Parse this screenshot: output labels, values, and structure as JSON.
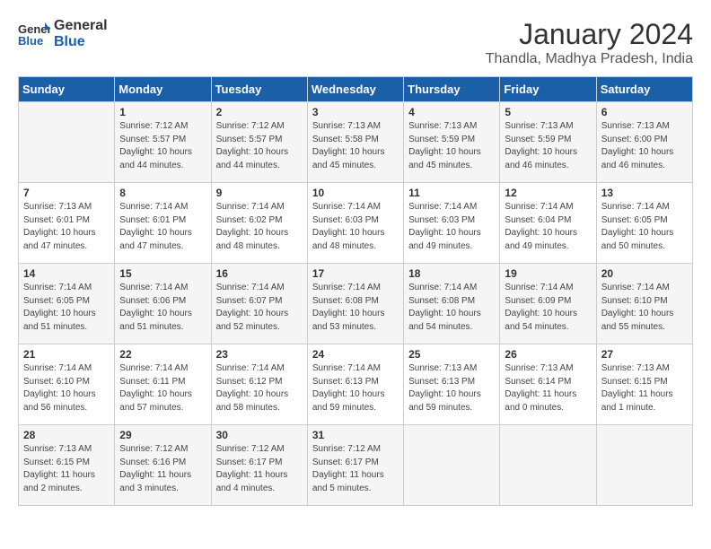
{
  "header": {
    "logo_line1": "General",
    "logo_line2": "Blue",
    "month": "January 2024",
    "location": "Thandla, Madhya Pradesh, India"
  },
  "days_of_week": [
    "Sunday",
    "Monday",
    "Tuesday",
    "Wednesday",
    "Thursday",
    "Friday",
    "Saturday"
  ],
  "weeks": [
    [
      {
        "day": "",
        "info": ""
      },
      {
        "day": "1",
        "info": "Sunrise: 7:12 AM\nSunset: 5:57 PM\nDaylight: 10 hours\nand 44 minutes."
      },
      {
        "day": "2",
        "info": "Sunrise: 7:12 AM\nSunset: 5:57 PM\nDaylight: 10 hours\nand 44 minutes."
      },
      {
        "day": "3",
        "info": "Sunrise: 7:13 AM\nSunset: 5:58 PM\nDaylight: 10 hours\nand 45 minutes."
      },
      {
        "day": "4",
        "info": "Sunrise: 7:13 AM\nSunset: 5:59 PM\nDaylight: 10 hours\nand 45 minutes."
      },
      {
        "day": "5",
        "info": "Sunrise: 7:13 AM\nSunset: 5:59 PM\nDaylight: 10 hours\nand 46 minutes."
      },
      {
        "day": "6",
        "info": "Sunrise: 7:13 AM\nSunset: 6:00 PM\nDaylight: 10 hours\nand 46 minutes."
      }
    ],
    [
      {
        "day": "7",
        "info": "Sunrise: 7:13 AM\nSunset: 6:01 PM\nDaylight: 10 hours\nand 47 minutes."
      },
      {
        "day": "8",
        "info": "Sunrise: 7:14 AM\nSunset: 6:01 PM\nDaylight: 10 hours\nand 47 minutes."
      },
      {
        "day": "9",
        "info": "Sunrise: 7:14 AM\nSunset: 6:02 PM\nDaylight: 10 hours\nand 48 minutes."
      },
      {
        "day": "10",
        "info": "Sunrise: 7:14 AM\nSunset: 6:03 PM\nDaylight: 10 hours\nand 48 minutes."
      },
      {
        "day": "11",
        "info": "Sunrise: 7:14 AM\nSunset: 6:03 PM\nDaylight: 10 hours\nand 49 minutes."
      },
      {
        "day": "12",
        "info": "Sunrise: 7:14 AM\nSunset: 6:04 PM\nDaylight: 10 hours\nand 49 minutes."
      },
      {
        "day": "13",
        "info": "Sunrise: 7:14 AM\nSunset: 6:05 PM\nDaylight: 10 hours\nand 50 minutes."
      }
    ],
    [
      {
        "day": "14",
        "info": "Sunrise: 7:14 AM\nSunset: 6:05 PM\nDaylight: 10 hours\nand 51 minutes."
      },
      {
        "day": "15",
        "info": "Sunrise: 7:14 AM\nSunset: 6:06 PM\nDaylight: 10 hours\nand 51 minutes."
      },
      {
        "day": "16",
        "info": "Sunrise: 7:14 AM\nSunset: 6:07 PM\nDaylight: 10 hours\nand 52 minutes."
      },
      {
        "day": "17",
        "info": "Sunrise: 7:14 AM\nSunset: 6:08 PM\nDaylight: 10 hours\nand 53 minutes."
      },
      {
        "day": "18",
        "info": "Sunrise: 7:14 AM\nSunset: 6:08 PM\nDaylight: 10 hours\nand 54 minutes."
      },
      {
        "day": "19",
        "info": "Sunrise: 7:14 AM\nSunset: 6:09 PM\nDaylight: 10 hours\nand 54 minutes."
      },
      {
        "day": "20",
        "info": "Sunrise: 7:14 AM\nSunset: 6:10 PM\nDaylight: 10 hours\nand 55 minutes."
      }
    ],
    [
      {
        "day": "21",
        "info": "Sunrise: 7:14 AM\nSunset: 6:10 PM\nDaylight: 10 hours\nand 56 minutes."
      },
      {
        "day": "22",
        "info": "Sunrise: 7:14 AM\nSunset: 6:11 PM\nDaylight: 10 hours\nand 57 minutes."
      },
      {
        "day": "23",
        "info": "Sunrise: 7:14 AM\nSunset: 6:12 PM\nDaylight: 10 hours\nand 58 minutes."
      },
      {
        "day": "24",
        "info": "Sunrise: 7:14 AM\nSunset: 6:13 PM\nDaylight: 10 hours\nand 59 minutes."
      },
      {
        "day": "25",
        "info": "Sunrise: 7:13 AM\nSunset: 6:13 PM\nDaylight: 10 hours\nand 59 minutes."
      },
      {
        "day": "26",
        "info": "Sunrise: 7:13 AM\nSunset: 6:14 PM\nDaylight: 11 hours\nand 0 minutes."
      },
      {
        "day": "27",
        "info": "Sunrise: 7:13 AM\nSunset: 6:15 PM\nDaylight: 11 hours\nand 1 minute."
      }
    ],
    [
      {
        "day": "28",
        "info": "Sunrise: 7:13 AM\nSunset: 6:15 PM\nDaylight: 11 hours\nand 2 minutes."
      },
      {
        "day": "29",
        "info": "Sunrise: 7:12 AM\nSunset: 6:16 PM\nDaylight: 11 hours\nand 3 minutes."
      },
      {
        "day": "30",
        "info": "Sunrise: 7:12 AM\nSunset: 6:17 PM\nDaylight: 11 hours\nand 4 minutes."
      },
      {
        "day": "31",
        "info": "Sunrise: 7:12 AM\nSunset: 6:17 PM\nDaylight: 11 hours\nand 5 minutes."
      },
      {
        "day": "",
        "info": ""
      },
      {
        "day": "",
        "info": ""
      },
      {
        "day": "",
        "info": ""
      }
    ]
  ]
}
